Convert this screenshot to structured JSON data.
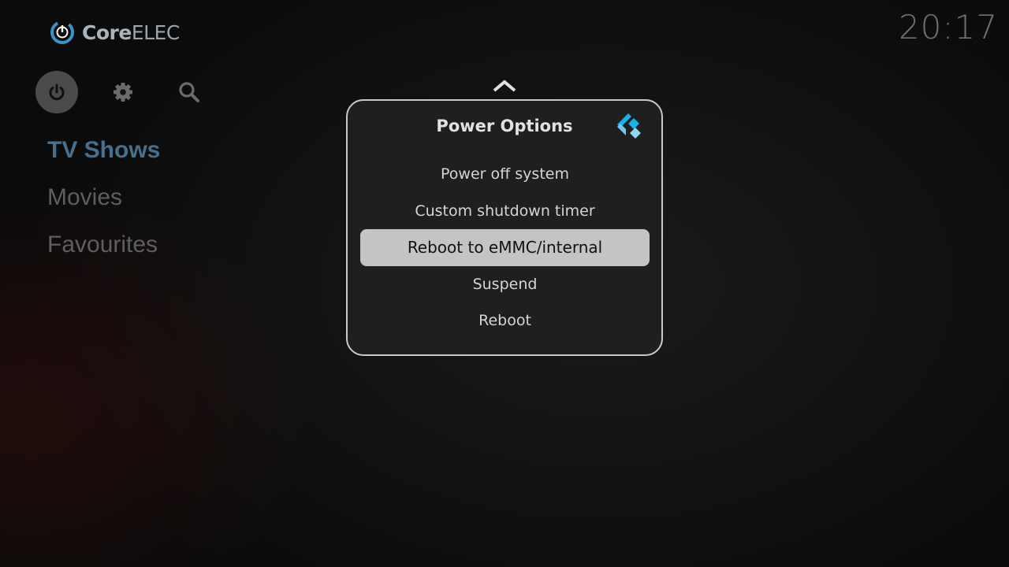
{
  "brand": {
    "name_bold": "Core",
    "name_regular": "ELEC",
    "accent_color": "#3a93c4"
  },
  "clock": {
    "time": "20:17"
  },
  "top_icons": [
    {
      "name": "power",
      "icon": "power-icon",
      "focused": true
    },
    {
      "name": "settings",
      "icon": "gear-icon",
      "focused": false
    },
    {
      "name": "search",
      "icon": "search-icon",
      "focused": false
    }
  ],
  "menu": {
    "items": [
      {
        "label": "TV Shows",
        "active": true
      },
      {
        "label": "Movies",
        "active": false
      },
      {
        "label": "Favourites",
        "active": false
      }
    ]
  },
  "dialog": {
    "title": "Power Options",
    "options": [
      {
        "label": "Power off system",
        "focused": false
      },
      {
        "label": "Custom shutdown timer",
        "focused": false
      },
      {
        "label": "Reboot to eMMC/internal",
        "focused": true
      },
      {
        "label": "Suspend",
        "focused": false
      },
      {
        "label": "Reboot",
        "focused": false
      }
    ]
  },
  "colors": {
    "menu_active": "#47708f",
    "menu_inactive": "#5e5e5e",
    "focus_highlight": "#c4c4c4",
    "dialog_bg": "#1f1f1f",
    "kodi_blue": "#17b2e7"
  }
}
